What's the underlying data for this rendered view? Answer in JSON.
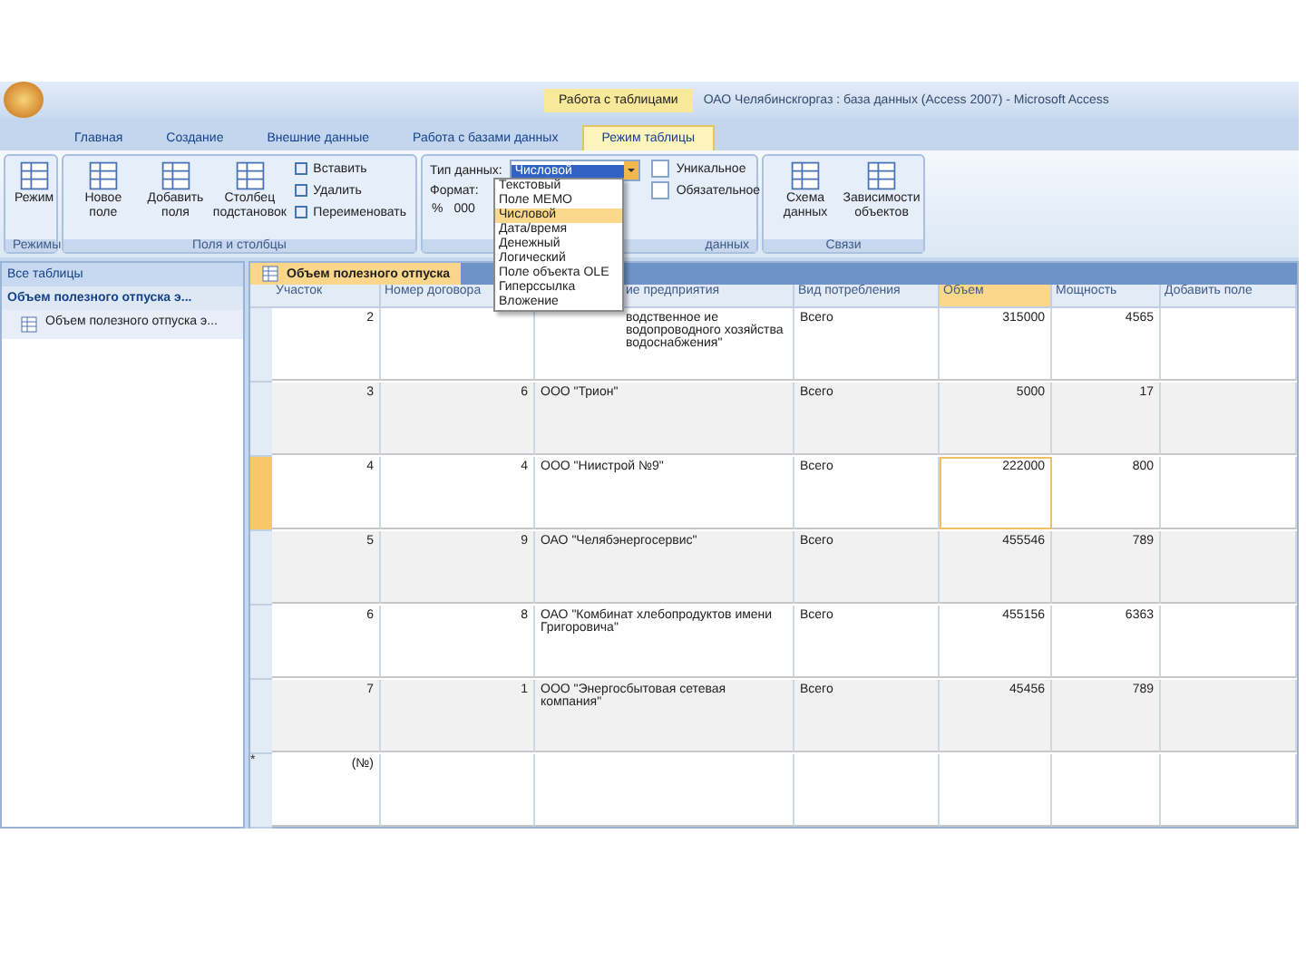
{
  "window": {
    "title": "ОАО Челябинскгоргаз : база данных (Access 2007) - Microsoft Access",
    "context_tab": "Работа с таблицами"
  },
  "tabs": [
    {
      "label": "Главная",
      "selected": false
    },
    {
      "label": "Создание",
      "selected": false
    },
    {
      "label": "Внешние данные",
      "selected": false
    },
    {
      "label": "Работа с базами данных",
      "selected": false
    },
    {
      "label": "Режим таблицы",
      "selected": true
    }
  ],
  "ribbon": {
    "groups": [
      {
        "label": "Режимы",
        "big_buttons": [
          {
            "label": "Режим"
          }
        ]
      },
      {
        "label": "Поля и столбцы",
        "big_buttons": [
          {
            "label": "Новое поле"
          },
          {
            "label": "Добавить поля"
          },
          {
            "label": "Столбец подстановок"
          }
        ],
        "small_buttons": [
          {
            "label": "Вставить"
          },
          {
            "label": "Удалить"
          },
          {
            "label": "Переименовать"
          }
        ]
      },
      {
        "label": "данных",
        "kind": "format"
      },
      {
        "label": "Связи",
        "big_buttons": [
          {
            "label": "Схема данных"
          },
          {
            "label": "Зависимости объектов"
          }
        ]
      }
    ],
    "data_type": {
      "label": "Тип данных:",
      "value": "Числовой"
    },
    "format": {
      "label": "Формат:",
      "symbols": [
        "%",
        "000"
      ]
    },
    "checks": [
      {
        "label": "Уникальное",
        "checked": false
      },
      {
        "label": "Обязательное",
        "checked": false
      }
    ],
    "type_menu": [
      {
        "label": "Текстовый",
        "selected": false
      },
      {
        "label": "Поле MEMO",
        "selected": false
      },
      {
        "label": "Числовой",
        "selected": true
      },
      {
        "label": "Дата/время",
        "selected": false
      },
      {
        "label": "Денежный",
        "selected": false
      },
      {
        "label": "Логический",
        "selected": false
      },
      {
        "label": "Поле объекта OLE",
        "selected": false
      },
      {
        "label": "Гиперссылка",
        "selected": false
      },
      {
        "label": "Вложение",
        "selected": false
      }
    ]
  },
  "nav": {
    "header": "Все таблицы",
    "group": "Объем полезного отпуска э...",
    "items": [
      "Объем полезного отпуска э..."
    ]
  },
  "document_tab": "Объем полезного отпуска",
  "table": {
    "columns": [
      {
        "label": "Участок",
        "selected": false
      },
      {
        "label": "Номер договора",
        "selected": false
      },
      {
        "label": "ие предприятия",
        "selected": false
      },
      {
        "label": "Вид потребления",
        "selected": false
      },
      {
        "label": "Объем",
        "selected": true
      },
      {
        "label": "Мощность",
        "selected": false
      },
      {
        "label": "Добавить поле",
        "selected": false
      }
    ],
    "rows": [
      {
        "selected": false,
        "cells": [
          "2",
          "",
          "водственное ие водопроводного хозяйства водоснабжения\"",
          "Всего",
          "315000",
          "4565"
        ]
      },
      {
        "selected": false,
        "cells": [
          "3",
          "6",
          "ООО \"Трион\"",
          "Всего",
          "5000",
          "17"
        ]
      },
      {
        "selected": true,
        "cells": [
          "4",
          "4",
          "ООО \"Ниистрой №9\"",
          "Всего",
          "222000",
          "800"
        ]
      },
      {
        "selected": false,
        "cells": [
          "5",
          "9",
          "ОАО \"Челябэнергосервис\"",
          "Всего",
          "455546",
          "789"
        ]
      },
      {
        "selected": false,
        "cells": [
          "6",
          "8",
          "ОАО \"Комбинат хлебопродуктов имени Григоровича\"",
          "Всего",
          "455156",
          "6363"
        ]
      },
      {
        "selected": false,
        "cells": [
          "7",
          "1",
          "ООО \"Энергосбытовая сетевая компания\"",
          "Всего",
          "45456",
          "789"
        ]
      }
    ],
    "new_row": {
      "marker": "*",
      "placeholder": "(№)"
    }
  }
}
